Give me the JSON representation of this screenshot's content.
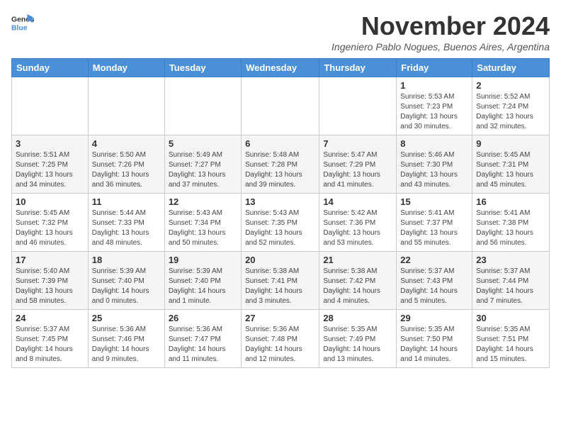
{
  "logo": {
    "general": "General",
    "blue": "Blue"
  },
  "header": {
    "month_title": "November 2024",
    "subtitle": "Ingeniero Pablo Nogues, Buenos Aires, Argentina"
  },
  "weekdays": [
    "Sunday",
    "Monday",
    "Tuesday",
    "Wednesday",
    "Thursday",
    "Friday",
    "Saturday"
  ],
  "weeks": [
    [
      {
        "day": "",
        "details": ""
      },
      {
        "day": "",
        "details": ""
      },
      {
        "day": "",
        "details": ""
      },
      {
        "day": "",
        "details": ""
      },
      {
        "day": "",
        "details": ""
      },
      {
        "day": "1",
        "details": "Sunrise: 5:53 AM\nSunset: 7:23 PM\nDaylight: 13 hours\nand 30 minutes."
      },
      {
        "day": "2",
        "details": "Sunrise: 5:52 AM\nSunset: 7:24 PM\nDaylight: 13 hours\nand 32 minutes."
      }
    ],
    [
      {
        "day": "3",
        "details": "Sunrise: 5:51 AM\nSunset: 7:25 PM\nDaylight: 13 hours\nand 34 minutes."
      },
      {
        "day": "4",
        "details": "Sunrise: 5:50 AM\nSunset: 7:26 PM\nDaylight: 13 hours\nand 36 minutes."
      },
      {
        "day": "5",
        "details": "Sunrise: 5:49 AM\nSunset: 7:27 PM\nDaylight: 13 hours\nand 37 minutes."
      },
      {
        "day": "6",
        "details": "Sunrise: 5:48 AM\nSunset: 7:28 PM\nDaylight: 13 hours\nand 39 minutes."
      },
      {
        "day": "7",
        "details": "Sunrise: 5:47 AM\nSunset: 7:29 PM\nDaylight: 13 hours\nand 41 minutes."
      },
      {
        "day": "8",
        "details": "Sunrise: 5:46 AM\nSunset: 7:30 PM\nDaylight: 13 hours\nand 43 minutes."
      },
      {
        "day": "9",
        "details": "Sunrise: 5:45 AM\nSunset: 7:31 PM\nDaylight: 13 hours\nand 45 minutes."
      }
    ],
    [
      {
        "day": "10",
        "details": "Sunrise: 5:45 AM\nSunset: 7:32 PM\nDaylight: 13 hours\nand 46 minutes."
      },
      {
        "day": "11",
        "details": "Sunrise: 5:44 AM\nSunset: 7:33 PM\nDaylight: 13 hours\nand 48 minutes."
      },
      {
        "day": "12",
        "details": "Sunrise: 5:43 AM\nSunset: 7:34 PM\nDaylight: 13 hours\nand 50 minutes."
      },
      {
        "day": "13",
        "details": "Sunrise: 5:43 AM\nSunset: 7:35 PM\nDaylight: 13 hours\nand 52 minutes."
      },
      {
        "day": "14",
        "details": "Sunrise: 5:42 AM\nSunset: 7:36 PM\nDaylight: 13 hours\nand 53 minutes."
      },
      {
        "day": "15",
        "details": "Sunrise: 5:41 AM\nSunset: 7:37 PM\nDaylight: 13 hours\nand 55 minutes."
      },
      {
        "day": "16",
        "details": "Sunrise: 5:41 AM\nSunset: 7:38 PM\nDaylight: 13 hours\nand 56 minutes."
      }
    ],
    [
      {
        "day": "17",
        "details": "Sunrise: 5:40 AM\nSunset: 7:39 PM\nDaylight: 13 hours\nand 58 minutes."
      },
      {
        "day": "18",
        "details": "Sunrise: 5:39 AM\nSunset: 7:40 PM\nDaylight: 14 hours\nand 0 minutes."
      },
      {
        "day": "19",
        "details": "Sunrise: 5:39 AM\nSunset: 7:40 PM\nDaylight: 14 hours\nand 1 minute."
      },
      {
        "day": "20",
        "details": "Sunrise: 5:38 AM\nSunset: 7:41 PM\nDaylight: 14 hours\nand 3 minutes."
      },
      {
        "day": "21",
        "details": "Sunrise: 5:38 AM\nSunset: 7:42 PM\nDaylight: 14 hours\nand 4 minutes."
      },
      {
        "day": "22",
        "details": "Sunrise: 5:37 AM\nSunset: 7:43 PM\nDaylight: 14 hours\nand 5 minutes."
      },
      {
        "day": "23",
        "details": "Sunrise: 5:37 AM\nSunset: 7:44 PM\nDaylight: 14 hours\nand 7 minutes."
      }
    ],
    [
      {
        "day": "24",
        "details": "Sunrise: 5:37 AM\nSunset: 7:45 PM\nDaylight: 14 hours\nand 8 minutes."
      },
      {
        "day": "25",
        "details": "Sunrise: 5:36 AM\nSunset: 7:46 PM\nDaylight: 14 hours\nand 9 minutes."
      },
      {
        "day": "26",
        "details": "Sunrise: 5:36 AM\nSunset: 7:47 PM\nDaylight: 14 hours\nand 11 minutes."
      },
      {
        "day": "27",
        "details": "Sunrise: 5:36 AM\nSunset: 7:48 PM\nDaylight: 14 hours\nand 12 minutes."
      },
      {
        "day": "28",
        "details": "Sunrise: 5:35 AM\nSunset: 7:49 PM\nDaylight: 14 hours\nand 13 minutes."
      },
      {
        "day": "29",
        "details": "Sunrise: 5:35 AM\nSunset: 7:50 PM\nDaylight: 14 hours\nand 14 minutes."
      },
      {
        "day": "30",
        "details": "Sunrise: 5:35 AM\nSunset: 7:51 PM\nDaylight: 14 hours\nand 15 minutes."
      }
    ]
  ]
}
